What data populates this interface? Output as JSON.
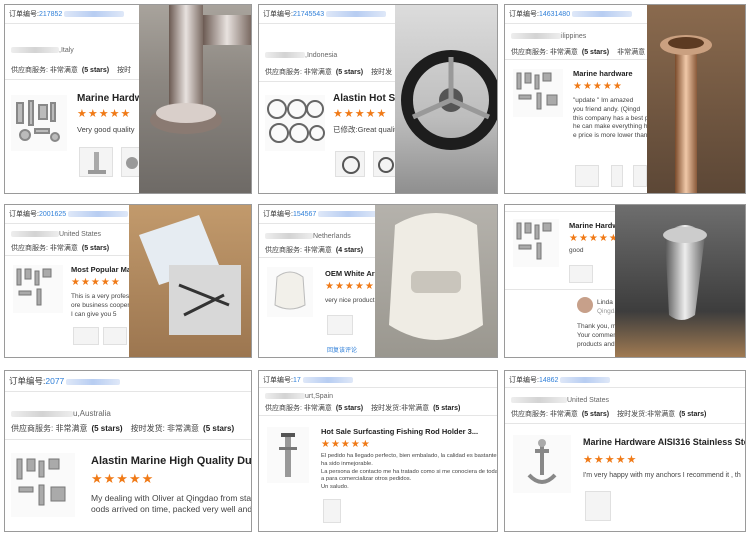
{
  "labels": {
    "order_no": "订单编号:",
    "service": "供应商服务: 非常满意",
    "service_short": "供应商服务:",
    "service_val": "非常满意",
    "ship": "按时发货:",
    "ship_val": "非常满意",
    "edited": "已修改:",
    "follow_up": "回复该评论"
  },
  "cards": [
    {
      "order": "217852",
      "buyer": ",Italy",
      "rating": "(5 stars)",
      "ship": "按时",
      "title": "Marine Hardw",
      "review": [
        "Very good quality"
      ]
    },
    {
      "order": "21745543",
      "buyer": ",Indonesia",
      "rating": "(5 stars)",
      "ship": "按时发",
      "title": "Alastin Hot Sel",
      "edited": "已修改:",
      "review": [
        "Great quality"
      ]
    },
    {
      "order": "14631480",
      "buyer": "ilippines",
      "rating": "(5 stars)",
      "ship": "非常满意",
      "title": "Marine hardware",
      "review": [
        "\"update \" Im amazed",
        "you friend andy. (Qingd",
        "",
        "this company has a best p",
        "he can make everything h",
        "e price is more lower than"
      ]
    },
    {
      "order": "2001625",
      "buyer": "United States",
      "rating": "(5 stars)",
      "title": "Most Popular Ma",
      "review": [
        "This is a very professio",
        "ore business cooperati",
        "I can give you 5"
      ]
    },
    {
      "order": "154567",
      "buyer": "Netherlands",
      "rating": "(4 stars)",
      "title": "OEM White Ar",
      "review": [
        "very nice product a"
      ],
      "follow": "回复该评论"
    },
    {
      "title": "Marine Hardw",
      "review": [
        "good"
      ],
      "rep_name": "Linda X",
      "rep_co": "Qingdao",
      "rep_text": [
        "Thank you, my fr",
        "Your comments",
        "products and e"
      ]
    },
    {
      "order": "2077",
      "buyer": "u,Australia",
      "rating": "(5 stars)",
      "ship": "按时发货: 非常满意",
      "ship_rating": "(5 stars)",
      "title": "Alastin Marine High Quality Dura",
      "review": [
        "My dealing with Oliver at Qingdao from sta",
        "oods arrived on time, packed very well and"
      ]
    },
    {
      "order": "17",
      "buyer": "urt,Spain",
      "rating": "(5 stars)",
      "ship_rating": "(5 stars)",
      "title": "Hot Sale Surfcasting Fishing Rod Holder 3...",
      "review": [
        "El pedido ha llegado perfecto, bien embalado, la calidad es bastante ac",
        "ha sido inmejorable.",
        "La persona de contacto me ha tratado como si me conociera de toda la vi",
        "a para comercializar otros pedidos.",
        "Un saludo."
      ]
    },
    {
      "order": "14862",
      "buyer": "United States",
      "rating": "(5 stars)",
      "ship_rating": "(5 stars)",
      "title": "Marine Hardware AISI316 Stainless Ste",
      "review": [
        "I'm very happy with my anchors I recommend it , th"
      ]
    }
  ],
  "stars": "★★★★★",
  "colors": {
    "accent": "#f07a17",
    "link": "#2f7fd8",
    "border": "#9a9a9a"
  }
}
